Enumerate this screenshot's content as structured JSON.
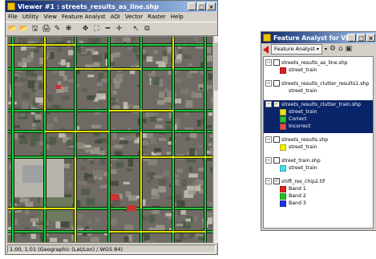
{
  "viewer": {
    "title": "Viewer #1 : streets_results_as_line.shp",
    "window_buttons": [
      "_",
      "□",
      "×"
    ],
    "menus": [
      "File",
      "Utility",
      "View",
      "Feature Analyst",
      "AOI",
      "Vector",
      "Raster",
      "Help"
    ],
    "toolbar_glyphs": [
      "📂",
      "📂",
      "🖫",
      "🖨",
      "✎",
      "❋",
      "✥",
      "⛶",
      "━",
      "✛",
      "↖",
      "⧉"
    ],
    "toolbar_glyph_names": [
      "open-icon",
      "open-folder-icon",
      "save-icon",
      "print-icon",
      "edit-icon",
      "clear-icon",
      "zoom-fit-icon",
      "fullscreen-icon",
      "measure-icon",
      "crosshair-icon",
      "pointer-icon",
      "inquire-icon"
    ],
    "status": "1.00, 1.01  (Geographic (Lat/Lon) / WGS 84)"
  },
  "feature_analyst": {
    "title": "Feature Analyst for Vie...",
    "window_buttons": [
      "_",
      "□",
      "×"
    ],
    "dropdown_label": "Feature Analyst",
    "layers": [
      {
        "name": "streets_results_as_line.shp",
        "checked": false,
        "legend": [
          {
            "label": "street_train",
            "color": "#e02020"
          }
        ]
      },
      {
        "name": "streets_results_clutter_results1.shp",
        "checked": false,
        "legend": [
          {
            "label": "street_train",
            "color": ""
          }
        ]
      },
      {
        "name": "streets_results_clutter_train.shp",
        "checked": true,
        "selected": true,
        "legend": [
          {
            "label": "street_train",
            "color": "#f0e020"
          },
          {
            "label": "Correct",
            "color": "#30c030"
          },
          {
            "label": "Incorrect",
            "color": "#e05050"
          }
        ]
      },
      {
        "name": "streets_results.shp",
        "checked": false,
        "legend": [
          {
            "label": "street_train",
            "color": "#f0f000"
          }
        ]
      },
      {
        "name": "street_train.shp",
        "checked": false,
        "legend": [
          {
            "label": "street_train",
            "color": "#40e0f0"
          }
        ]
      },
      {
        "name": "shift_res_chip2.tif",
        "checked": true,
        "legend": [
          {
            "label": "Band 1",
            "color": "#e02020"
          },
          {
            "label": "Band 2",
            "color": "#20c020"
          },
          {
            "label": "Band 3",
            "color": "#2030e0"
          }
        ]
      }
    ]
  },
  "colors": {
    "title_start": "#0a246a",
    "title_end": "#a6caf0",
    "road_green": "#22c83a",
    "road_yellow": "#e8e000",
    "road_black": "#101010"
  }
}
